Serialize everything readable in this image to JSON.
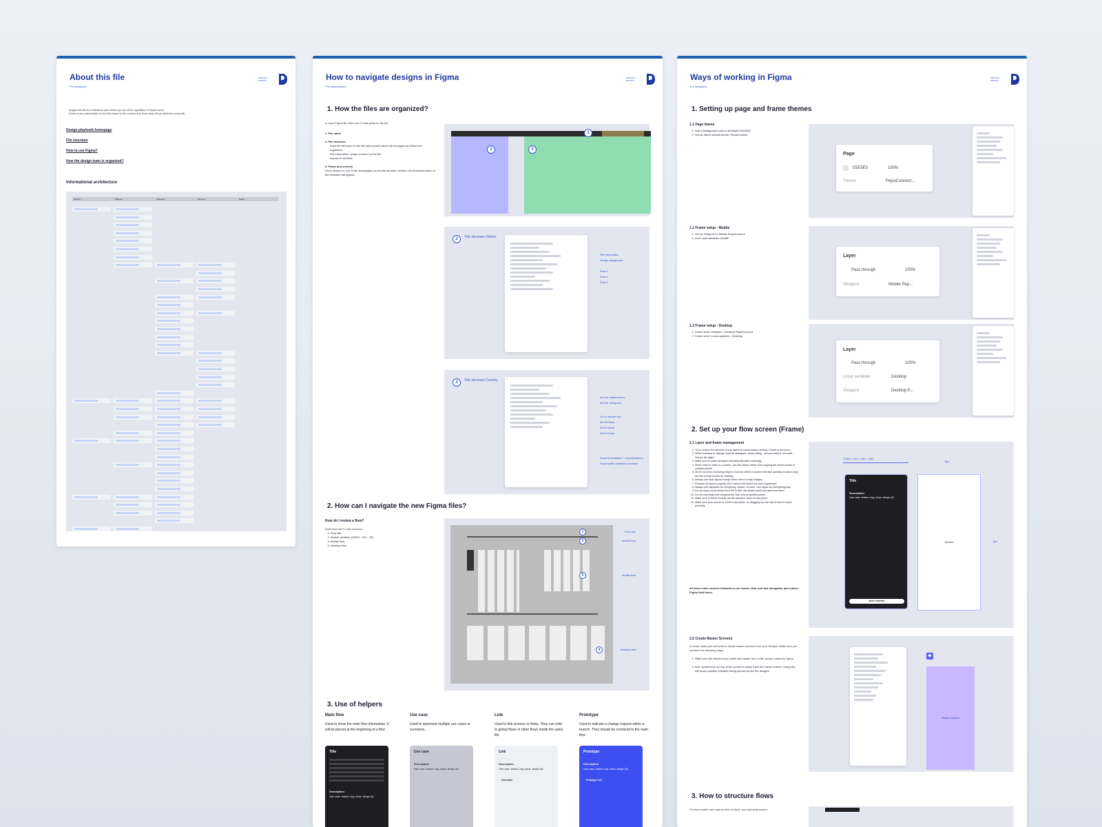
{
  "panel1": {
    "title": "About this file",
    "subtitle": "For designers",
    "bullets": [
      "Imagine this file as a centralised place where you see all the capabilities of PepsiConnect.",
      "If there is any customisation for the BUs based on the common flow, those flows will go within the country file."
    ],
    "links": [
      "Design playbook homepage",
      "File structure",
      "How to use Figma?",
      "How the design team is organized?"
    ],
    "ia_heading": "Informational architecture",
    "ia_columns": [
      "Section",
      "Platform",
      "Subflows",
      "Screens",
      "Notes"
    ]
  },
  "panel2": {
    "title": "How to navigate designs in Figma",
    "subtitle": "For stakeholders",
    "s1_heading": "1. How the files are organized?",
    "s1_intro": "In each Figma file, there are 3 main parts on the file:",
    "s1_items": [
      {
        "label": "1. File name",
        "text": ""
      },
      {
        "label": "2. File structure",
        "text": "Each file will have on the left side a panel where all the pages and flows are organised."
      },
      {
        "label": "",
        "text": "File information: scope covered on the file"
      },
      {
        "label": "",
        "text": "Access to all flows"
      },
      {
        "label": "3. Flows and screens",
        "text": "Once clicked on one of the flows/pages on the file structure section, the flow/information of the selection will appear."
      }
    ],
    "fs_global_num": "2",
    "fs_global_label": "File structure Global",
    "fs_global_annotations": [
      "File information",
      "Design playground",
      "Flow 1",
      "Flow 2",
      "Flow 3"
    ],
    "fs_country_num": "2",
    "fs_country_label": "File structure Country",
    "fs_country_annotations": [
      "Info for stakeholders",
      "Info for designers",
      "Go to market info",
      "All FM flows",
      "All DD flows",
      "All DS flows",
      "Screens available + customizations",
      "Expandable questions sections"
    ],
    "s2_heading": "2. How can I navigate the new Figma files?",
    "s2_sub": "How do I review a flow?",
    "s2_intro": "Each flow has 3 main sections:",
    "s2_items": [
      "Flow title",
      "Market variation (CEDO - DO - CE)",
      "Mobile flow",
      "Desktop flow"
    ],
    "s2_annotations": [
      "Flow title",
      "Market flow",
      "Mobile flow",
      "Desktop flow"
    ],
    "s3_heading": "3. Use of helpers",
    "helpers": [
      {
        "title": "Main flow",
        "desc": "Used to show the main flow information. It will be placed at the beginning of a flow",
        "card_title": "Title",
        "card_desc_label": "Description",
        "card_desc": "User case, feature, bug, issue, design QA"
      },
      {
        "title": "Use case",
        "desc": "Used to represent multiple use cases or scenarios.",
        "card_title": "Use case",
        "card_desc_label": "Description",
        "card_desc": "User case, feature, bug, issue, design QA"
      },
      {
        "title": "Link",
        "desc": "Used to link screens or flows. They can refer to global flows or other flows inside the same file.",
        "card_title": "Link",
        "card_desc_label": "Description",
        "card_desc": "User case, feature, bug, issue, design QA",
        "card_link": "View flow"
      },
      {
        "title": "Prototype",
        "desc": "Used to indicate a change request within a branch. They should be connectd to the main flow",
        "card_title": "Prototype",
        "card_desc_label": "Description",
        "card_desc": "User case, feature, bug, issue, design QA",
        "card_link": "Prototype link"
      }
    ]
  },
  "panel3": {
    "title": "Ways of working in Figma",
    "subtitle": "For designers",
    "s1_heading": "1. Setting up page and frame themes",
    "page_theme": {
      "heading": "1.1 Page theme",
      "steps": [
        "Add a background color to all pages #040404",
        "Set up theme default theme: PepsiConnect"
      ],
      "ui_title": "Page",
      "ui_hex": "E5E5E5",
      "ui_pct": "100%",
      "ui_theme_label": "Theme",
      "ui_theme_val": "PepsiConnect..."
    },
    "frame_mobile": {
      "heading": "1.1 Frame setup - Mobile",
      "steps": [
        "Set up Viewport to: Mobile PepsiConnect",
        "And Local variables: Mobile"
      ],
      "ui_title": "Layer",
      "ui_blend": "Pass through",
      "ui_pct": "100%",
      "ui_viewport_label": "Viewport",
      "ui_viewport_val": "Mobile Pep..."
    },
    "frame_desktop": {
      "heading": "1.3 Frame setup - Desktop",
      "steps": [
        "Frame level: Viewport = Desktop PepsiConnect",
        "Frame level: Local variables = Desktop"
      ],
      "ui_title": "Layer",
      "ui_blend": "Pass through",
      "ui_pct": "100%",
      "ui_localvar_label": "Local variables",
      "ui_localvar_val": "Desktop",
      "ui_viewport_label": "Viewport",
      "ui_viewport_val": "Desktop P..."
    },
    "s2_heading": "2. Set up your flow screen (Frame)",
    "layer_mgmt": {
      "heading": "2.1 Layer and frame management",
      "rules": [
        "Try to reduce the amount of sub layers to unnecessary nesting. Frame is not union.",
        "When overlays or dialogs must be displayed, avoid hiding - remove what is not used - reduce file wight.",
        "Make sure to name all layers semantically (with meaning).",
        "When need to refer to a screen, use the helper rather than copying the same screen in multiple places",
        "All the screens, including helpers must be within a section with 8px padding to allow copy the link of that screen for sharing.",
        "Always use auto layout except when need to wrap images.",
        "Rename all layers properly (No Frame1234 should be seen anywhere)",
        "Always use variables for everything. Space, corners. Use styles for everything else.",
        "Do not copy components from DS to file! Use Asset panel and add from there.",
        "Do not manually edit components! Use only properties panel.",
        "Make sure to follow exactly the file structure down to last pixel!",
        "Make sure your screen is 100% responsive, so dragging by one side it has to resize perfectly."
      ],
      "footer": "All these rules must be followed so we ensure clear and fast navigation and reduce Figma load times.",
      "dim_label": "375px = 3px + 8px + 8px",
      "pad_label": "8px",
      "card_title": "Title",
      "card_desc_label": "Description",
      "card_desc": "User case, feature, bug, issue, design QA",
      "card_button": "NEXT STARTED",
      "screen_label": "Screen"
    },
    "master": {
      "heading": "2.2 Create Master Screens",
      "intro": "In some cases you will need to create master screens from your designs. Make sure you consider the following steps",
      "steps": [
        "Make sure the element you create the master from is the screen inside the frame.",
        "Add \"symbol icon on top of the screen to easily track the master screen. Doing this will avoid possible mistakes being spread across the designs."
      ],
      "screen_label": "Master Screen"
    },
    "s3_heading": "3. How to structure flows",
    "s3_text": "For flow header use main section in black, and add what screen"
  },
  "colors": {
    "accent": "#1d5fb0",
    "title_blue": "#1f3a9e",
    "link_blue": "#2f55c9",
    "prototype_blue": "#3d4ff0",
    "lavender": "#b5b8ff",
    "mint": "#8fdcb0"
  }
}
